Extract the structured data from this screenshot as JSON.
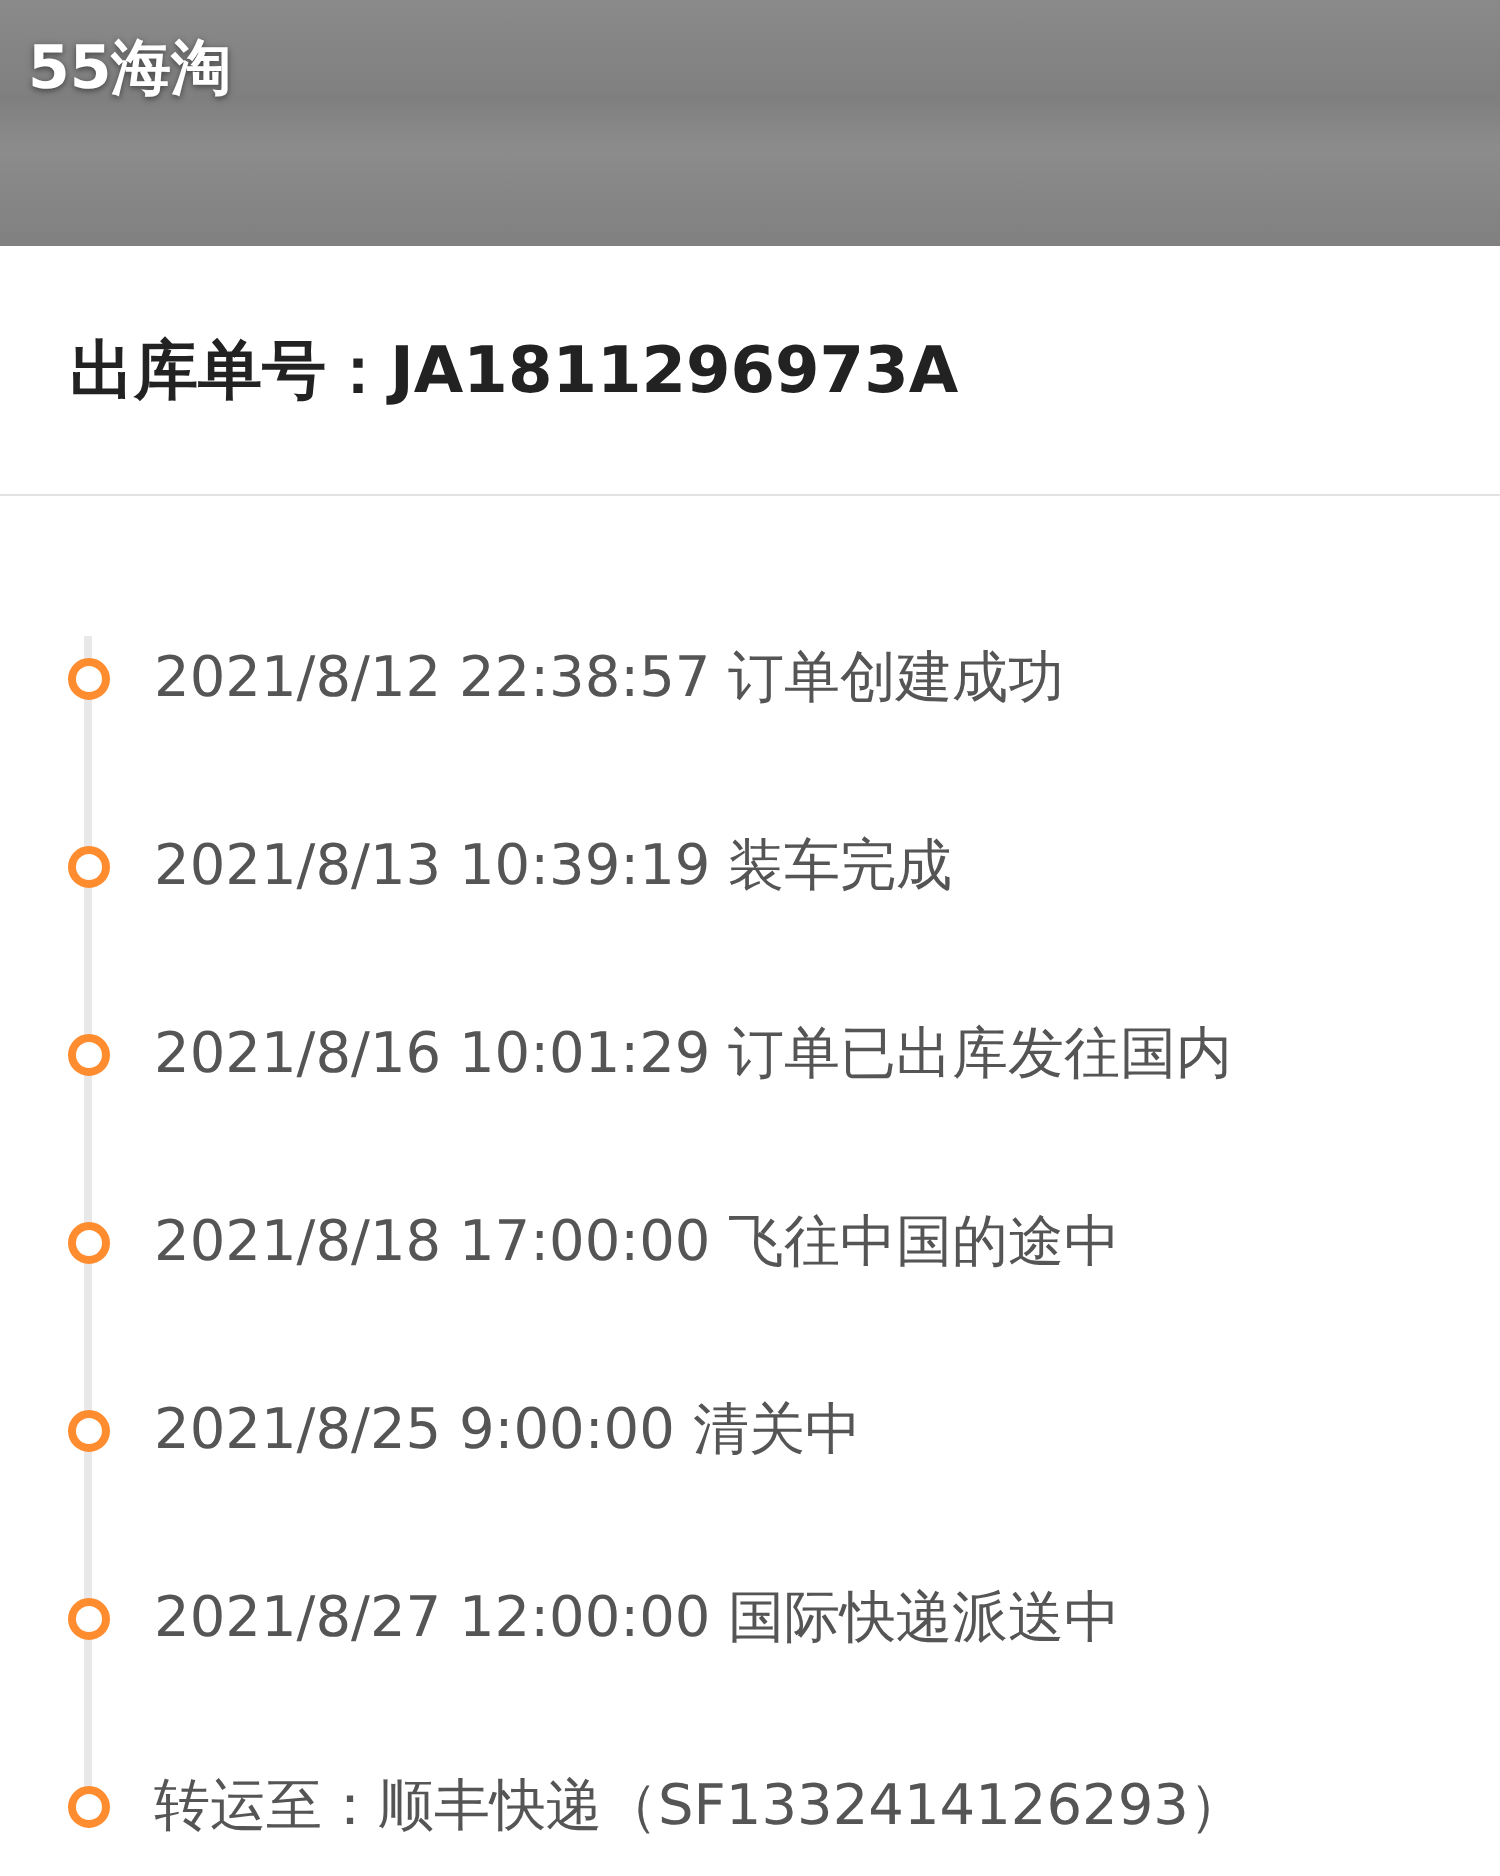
{
  "header": {
    "title": "55海淘"
  },
  "order": {
    "label": "出库单号：JA1811296973A"
  },
  "timeline": [
    {
      "text": "2021/8/12 22:38:57 订单创建成功"
    },
    {
      "text": "2021/8/13 10:39:19 装车完成"
    },
    {
      "text": "2021/8/16 10:01:29 订单已出库发往国内"
    },
    {
      "text": "2021/8/18 17:00:00 飞往中国的途中"
    },
    {
      "text": "2021/8/25 9:00:00 清关中"
    },
    {
      "text": "2021/8/27 12:00:00 国际快递派送中"
    },
    {
      "text": "转运至：顺丰快递（SF1332414126293）"
    }
  ]
}
